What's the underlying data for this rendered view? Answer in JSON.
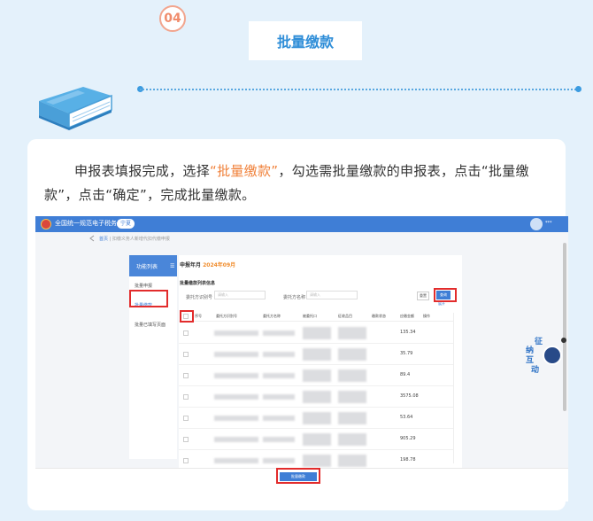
{
  "header": {
    "step_number": "04",
    "title": "批量缴款"
  },
  "intro": {
    "part1": "申报表填报完成，选择",
    "highlight": "“批量缴款”",
    "part2": "，勾选需批量缴款的申报表，点击“批量缴款”，点击“确定”，完成批量缴款。"
  },
  "screenshot": {
    "system_title": "全国统一规范电子税务局",
    "region": "宁夏",
    "user_name": "***",
    "breadcrumb": {
      "home": "首页",
      "separator": "|",
      "current": "扣缴义务人新增代扣代缴申报"
    },
    "left_nav": {
      "title": "功能列表",
      "menu_icon": "menu-icon",
      "items": [
        {
          "label": "批量申报",
          "active": false
        },
        {
          "label": "批量缴款",
          "active": true
        },
        {
          "label": "批量已填写页面",
          "active": false
        }
      ]
    },
    "period": {
      "label": "申报年月",
      "value": "2024年09月"
    },
    "section_title": "批量缴款列表信息",
    "filters": [
      {
        "label": "委托方识别号",
        "placeholder": "请输入"
      },
      {
        "label": "委托方名称",
        "placeholder": "请输入"
      }
    ],
    "buttons": {
      "reset": "重置",
      "query": "查询",
      "expand": "展开",
      "batch_pay": "批量缴款"
    },
    "table": {
      "headers": [
        "序号",
        "委托方识别号",
        "委托方名称",
        "被委托口",
        "征收品目",
        "缴款状态",
        "应缴金额",
        "操作"
      ],
      "rows": [
        {
          "amount": "135.34"
        },
        {
          "amount": "35.79"
        },
        {
          "amount": "89.4"
        },
        {
          "amount": "3575.08"
        },
        {
          "amount": "53.64"
        },
        {
          "amount": "905.29"
        },
        {
          "amount": "198.78"
        }
      ]
    },
    "widget": {
      "chars": [
        "征",
        "纳",
        "互",
        "动"
      ]
    },
    "colors": {
      "accent": "#3f7ed6",
      "highlight_box": "#e22c2c",
      "highlight_text": "#f0813a"
    }
  }
}
